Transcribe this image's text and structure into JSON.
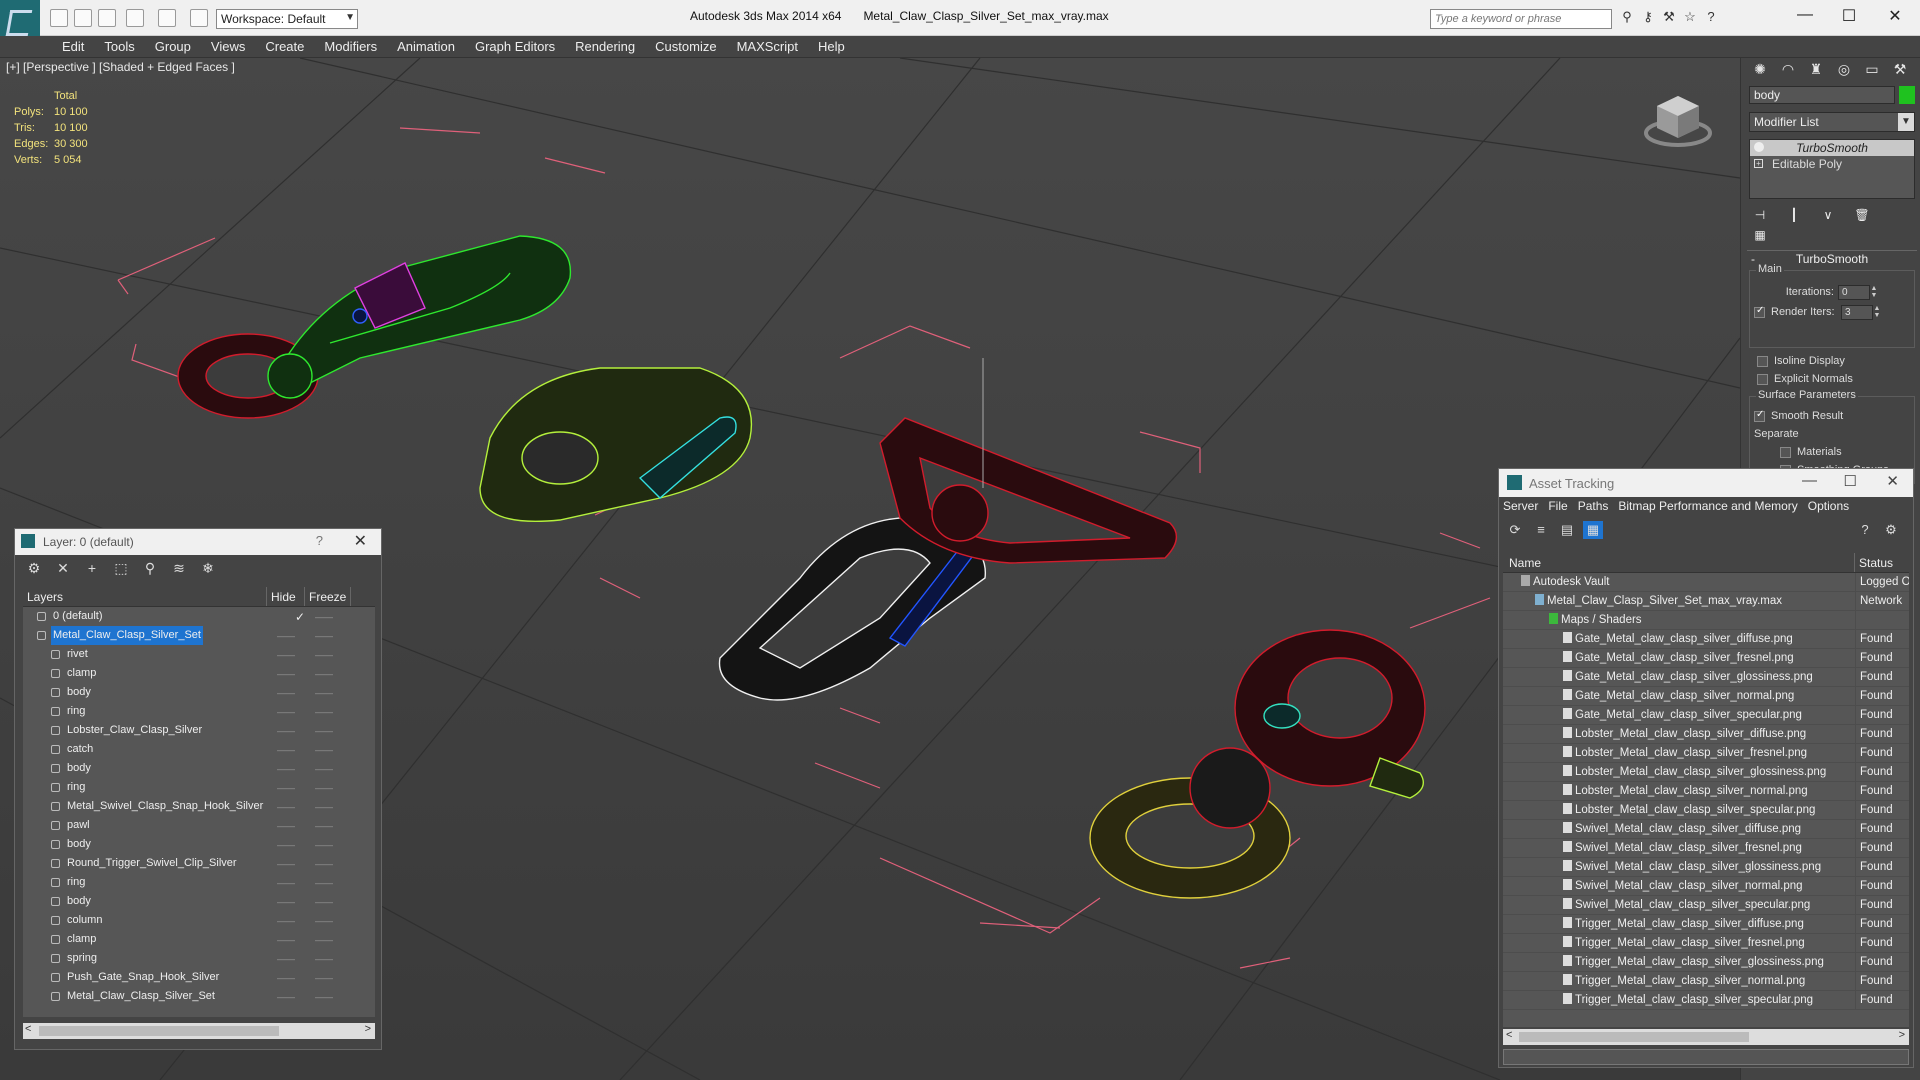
{
  "app": {
    "title": "Autodesk 3ds Max  2014 x64",
    "file": "Metal_Claw_Clasp_Silver_Set_max_vray.max",
    "workspace": "Workspace: Default",
    "search_placeholder": "Type a keyword or phrase"
  },
  "menu": [
    "Edit",
    "Tools",
    "Group",
    "Views",
    "Create",
    "Modifiers",
    "Animation",
    "Graph Editors",
    "Rendering",
    "Customize",
    "MAXScript",
    "Help"
  ],
  "viewport": {
    "label": "[+] [Perspective ] [Shaded + Edged Faces ]",
    "stats": {
      "header": "Total",
      "rows": [
        {
          "k": "Polys:",
          "v": "10 100"
        },
        {
          "k": "Tris:",
          "v": "10 100"
        },
        {
          "k": "Edges:",
          "v": "30 300"
        },
        {
          "k": "Verts:",
          "v": "5 054"
        }
      ]
    }
  },
  "command_panel": {
    "object_name": "body",
    "object_color": "#1fc21f",
    "modifier_list": "Modifier List",
    "stack": [
      "TurboSmooth",
      "Editable Poly"
    ],
    "rollout_title": "TurboSmooth",
    "main_group": "Main",
    "iterations_label": "Iterations:",
    "iterations_value": "0",
    "render_iters_label": "Render Iters:",
    "render_iters_value": "3",
    "isoline": "Isoline Display",
    "explicit_normals": "Explicit Normals",
    "surface_group": "Surface Parameters",
    "smooth_result": "Smooth Result",
    "separate": "Separate",
    "materials": "Materials",
    "smoothing_groups": "Smoothing Groups"
  },
  "layer_window": {
    "title": "Layer: 0 (default)",
    "col_layers": "Layers",
    "col_hide": "Hide",
    "col_freeze": "Freeze",
    "rows": [
      {
        "name": "0 (default)",
        "level": 1,
        "type": "layer"
      },
      {
        "name": "Metal_Claw_Clasp_Silver_Set",
        "level": 1,
        "type": "layer",
        "selected": true
      },
      {
        "name": "rivet",
        "level": 2,
        "type": "obj"
      },
      {
        "name": "clamp",
        "level": 2,
        "type": "obj"
      },
      {
        "name": "body",
        "level": 2,
        "type": "obj"
      },
      {
        "name": "ring",
        "level": 2,
        "type": "obj"
      },
      {
        "name": "Lobster_Claw_Clasp_Silver",
        "level": 2,
        "type": "obj"
      },
      {
        "name": "catch",
        "level": 2,
        "type": "obj"
      },
      {
        "name": "body",
        "level": 2,
        "type": "obj"
      },
      {
        "name": "ring",
        "level": 2,
        "type": "obj"
      },
      {
        "name": "Metal_Swivel_Clasp_Snap_Hook_Silver",
        "level": 2,
        "type": "obj"
      },
      {
        "name": "pawl",
        "level": 2,
        "type": "obj"
      },
      {
        "name": "body",
        "level": 2,
        "type": "obj"
      },
      {
        "name": "Round_Trigger_Swivel_Clip_Silver",
        "level": 2,
        "type": "obj"
      },
      {
        "name": "ring",
        "level": 2,
        "type": "obj"
      },
      {
        "name": "body",
        "level": 2,
        "type": "obj"
      },
      {
        "name": "column",
        "level": 2,
        "type": "obj"
      },
      {
        "name": "clamp",
        "level": 2,
        "type": "obj"
      },
      {
        "name": "spring",
        "level": 2,
        "type": "obj"
      },
      {
        "name": "Push_Gate_Snap_Hook_Silver",
        "level": 2,
        "type": "obj"
      },
      {
        "name": "Metal_Claw_Clasp_Silver_Set",
        "level": 2,
        "type": "obj"
      }
    ]
  },
  "asset_tracking": {
    "title": "Asset Tracking",
    "menu": [
      "Server",
      "File",
      "Paths",
      "Bitmap Performance and Memory",
      "Options"
    ],
    "col_name": "Name",
    "col_status": "Status",
    "rows": [
      {
        "name": "Autodesk Vault",
        "status": "Logged O",
        "level": 1
      },
      {
        "name": "Metal_Claw_Clasp_Silver_Set_max_vray.max",
        "status": "Network",
        "level": 2
      },
      {
        "name": "Maps / Shaders",
        "status": "",
        "level": 3
      },
      {
        "name": "Gate_Metal_claw_clasp_silver_diffuse.png",
        "status": "Found",
        "level": 4
      },
      {
        "name": "Gate_Metal_claw_clasp_silver_fresnel.png",
        "status": "Found",
        "level": 4
      },
      {
        "name": "Gate_Metal_claw_clasp_silver_glossiness.png",
        "status": "Found",
        "level": 4
      },
      {
        "name": "Gate_Metal_claw_clasp_silver_normal.png",
        "status": "Found",
        "level": 4
      },
      {
        "name": "Gate_Metal_claw_clasp_silver_specular.png",
        "status": "Found",
        "level": 4
      },
      {
        "name": "Lobster_Metal_claw_clasp_silver_diffuse.png",
        "status": "Found",
        "level": 4
      },
      {
        "name": "Lobster_Metal_claw_clasp_silver_fresnel.png",
        "status": "Found",
        "level": 4
      },
      {
        "name": "Lobster_Metal_claw_clasp_silver_glossiness.png",
        "status": "Found",
        "level": 4
      },
      {
        "name": "Lobster_Metal_claw_clasp_silver_normal.png",
        "status": "Found",
        "level": 4
      },
      {
        "name": "Lobster_Metal_claw_clasp_silver_specular.png",
        "status": "Found",
        "level": 4
      },
      {
        "name": "Swivel_Metal_claw_clasp_silver_diffuse.png",
        "status": "Found",
        "level": 4
      },
      {
        "name": "Swivel_Metal_claw_clasp_silver_fresnel.png",
        "status": "Found",
        "level": 4
      },
      {
        "name": "Swivel_Metal_claw_clasp_silver_glossiness.png",
        "status": "Found",
        "level": 4
      },
      {
        "name": "Swivel_Metal_claw_clasp_silver_normal.png",
        "status": "Found",
        "level": 4
      },
      {
        "name": "Swivel_Metal_claw_clasp_silver_specular.png",
        "status": "Found",
        "level": 4
      },
      {
        "name": "Trigger_Metal_claw_clasp_silver_diffuse.png",
        "status": "Found",
        "level": 4
      },
      {
        "name": "Trigger_Metal_claw_clasp_silver_fresnel.png",
        "status": "Found",
        "level": 4
      },
      {
        "name": "Trigger_Metal_claw_clasp_silver_glossiness.png",
        "status": "Found",
        "level": 4
      },
      {
        "name": "Trigger_Metal_claw_clasp_silver_normal.png",
        "status": "Found",
        "level": 4
      },
      {
        "name": "Trigger_Metal_claw_clasp_silver_specular.png",
        "status": "Found",
        "level": 4
      }
    ]
  }
}
